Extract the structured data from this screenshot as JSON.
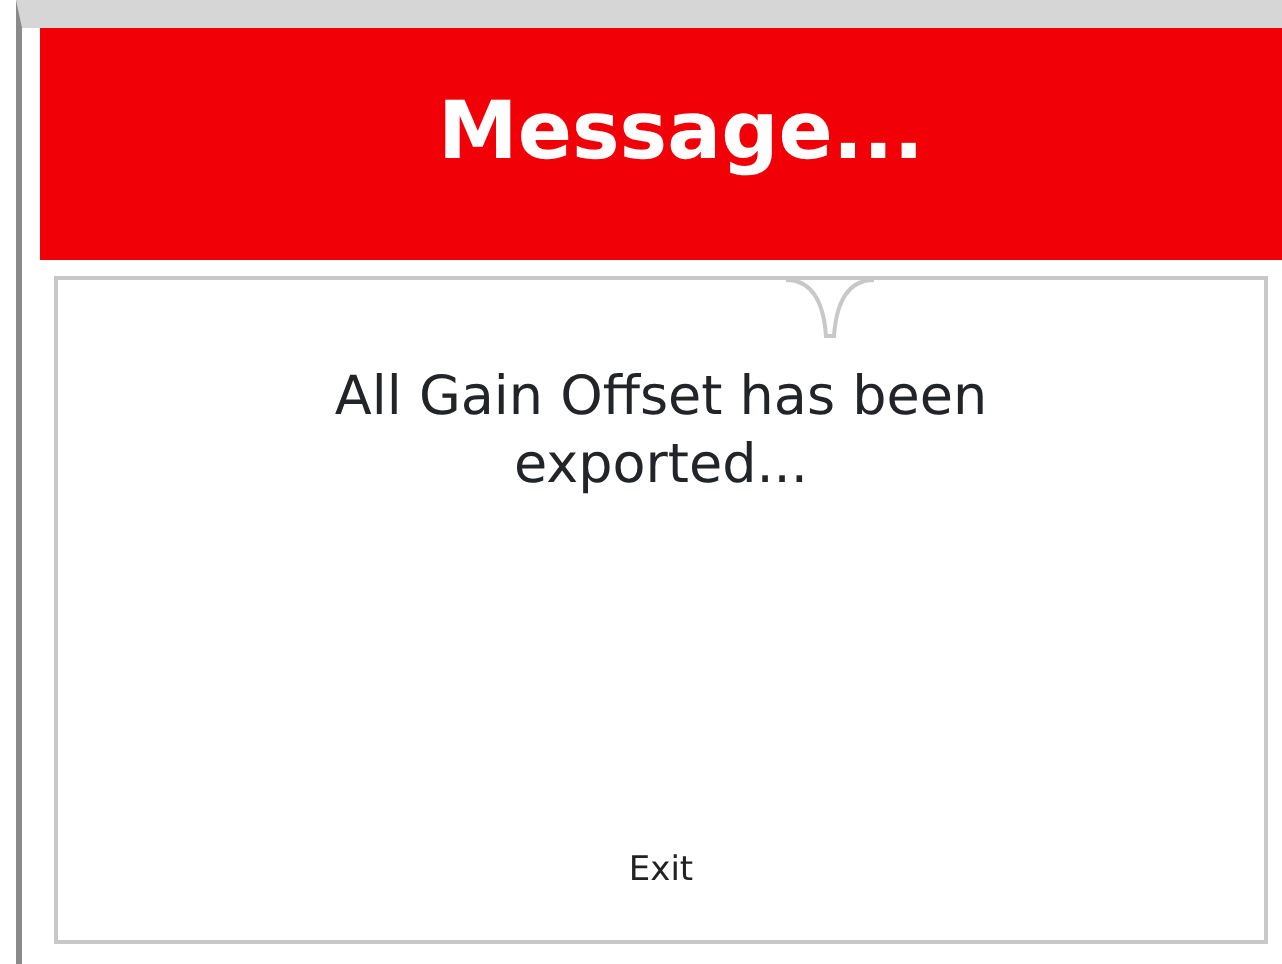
{
  "header": {
    "title": "Message..."
  },
  "message": "All Gain Offset has been exported...",
  "buttons": [
    {
      "label": "Exit"
    }
  ]
}
